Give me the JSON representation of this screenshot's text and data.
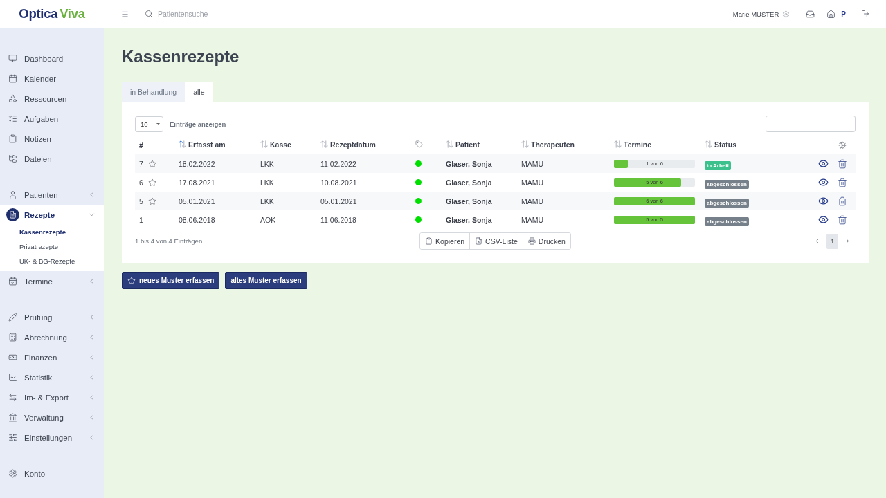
{
  "topbar": {
    "logo": {
      "part_1": "Optica",
      "part_2": "Viva"
    },
    "search": {
      "placeholder": "Patientensuche"
    },
    "user": "Marie MUSTER",
    "practice": "P"
  },
  "sidebar": {
    "groups": [
      {
        "items": [
          {
            "label": "Dashboard",
            "kind": "link",
            "selected": false
          },
          {
            "label": "Kalender",
            "kind": "link",
            "selected": false
          },
          {
            "label": "Ressourcen",
            "kind": "link",
            "selected": false
          },
          {
            "label": "Aufgaben",
            "kind": "link",
            "selected": false
          },
          {
            "label": "Notizen",
            "kind": "link",
            "selected": false
          },
          {
            "label": "Dateien",
            "kind": "link",
            "selected": false
          }
        ]
      },
      {
        "items": [
          {
            "label": "Patienten",
            "kind": "menu",
            "selected": false,
            "expanded": false
          },
          {
            "label": "Rezepte",
            "kind": "menu",
            "selected": true,
            "expanded": true,
            "children": [
              {
                "label": "Kassenrezepte",
                "selected": true
              },
              {
                "label": "Privatrezepte",
                "selected": false
              },
              {
                "label": "UK- & BG-Rezepte",
                "selected": false
              }
            ]
          },
          {
            "label": "Termine",
            "kind": "menu",
            "selected": false,
            "expanded": false
          }
        ]
      },
      {
        "items": [
          {
            "label": "Prüfung",
            "kind": "menu",
            "selected": false,
            "expanded": false
          },
          {
            "label": "Abrechnung",
            "kind": "menu",
            "selected": false,
            "expanded": false
          },
          {
            "label": "Finanzen",
            "kind": "menu",
            "selected": false,
            "expanded": false
          },
          {
            "label": "Statistik",
            "kind": "menu",
            "selected": false,
            "expanded": false
          },
          {
            "label": "Im- & Export",
            "kind": "menu",
            "selected": false,
            "expanded": false
          },
          {
            "label": "Verwaltung",
            "kind": "menu",
            "selected": false,
            "expanded": false
          },
          {
            "label": "Einstellungen",
            "kind": "menu",
            "selected": false,
            "expanded": false
          }
        ]
      },
      {
        "items": [
          {
            "label": "Konto",
            "kind": "link",
            "selected": false
          }
        ]
      }
    ]
  },
  "page": {
    "title": "Kassenrezepte",
    "tabs": [
      {
        "label": "in Behandlung",
        "selected": false
      },
      {
        "label": "alle",
        "selected": true
      }
    ],
    "page_length": {
      "value": "10",
      "label": "Einträge anzeigen"
    },
    "table": {
      "columns": [
        {
          "label": "#",
          "kind": "plain"
        },
        {
          "label": "Erfasst am",
          "kind": "sortable",
          "sorted": true
        },
        {
          "label": "Kasse",
          "kind": "sortable",
          "sorted": false
        },
        {
          "label": "Rezeptdatum",
          "kind": "sortable",
          "sorted": false
        },
        {
          "kind": "tag_icon"
        },
        {
          "label": "Patient",
          "kind": "sortable",
          "sorted": false
        },
        {
          "label": "Therapeuten",
          "kind": "sortable",
          "sorted": false
        },
        {
          "label": "Termine",
          "kind": "sortable",
          "sorted": false
        },
        {
          "label": "Status",
          "kind": "sortable",
          "sorted": false
        },
        {
          "kind": "settings_icon"
        }
      ],
      "rows": [
        {
          "number": "7",
          "star_icon": true,
          "recorded": "18.02.2022",
          "insurer": "LKK",
          "prescription_date": "11.02.2022",
          "tag": {
            "color": "#00e000"
          },
          "patient": "Glaser, Sonja",
          "therapist": "MAMU",
          "appointments": {
            "label": "1 von 6",
            "level": 0.167
          },
          "status": {
            "label": "in Arbeit",
            "color": "#3cc08c"
          }
        },
        {
          "number": "6",
          "star_icon": true,
          "recorded": "17.08.2021",
          "insurer": "LKK",
          "prescription_date": "10.08.2021",
          "tag": {
            "color": "#00e000"
          },
          "patient": "Glaser, Sonja",
          "therapist": "MAMU",
          "appointments": {
            "label": "5 von 6",
            "level": 0.833
          },
          "status": {
            "label": "abgeschlossen",
            "color": "#76808a"
          }
        },
        {
          "number": "5",
          "star_icon": true,
          "recorded": "05.01.2021",
          "insurer": "LKK",
          "prescription_date": "05.01.2021",
          "tag": {
            "color": "#00e000"
          },
          "patient": "Glaser, Sonja",
          "therapist": "MAMU",
          "appointments": {
            "label": "6 von 6",
            "level": 1
          },
          "status": {
            "label": "abgeschlossen",
            "color": "#76808a"
          }
        },
        {
          "number": "1",
          "star_icon": false,
          "recorded": "08.06.2018",
          "insurer": "AOK",
          "prescription_date": "11.06.2018",
          "tag": {
            "color": "#00e000"
          },
          "patient": "Glaser, Sonja",
          "therapist": "MAMU",
          "appointments": {
            "label": "5 von 5",
            "level": 1
          },
          "status": {
            "label": "abgeschlossen",
            "color": "#76808a"
          }
        }
      ]
    },
    "footer": {
      "info": "1 bis 4 von 4 Einträgen",
      "export_buttons": [
        {
          "label": "Kopieren"
        },
        {
          "label": "CSV-Liste"
        },
        {
          "label": "Drucken"
        }
      ],
      "pages": [
        {
          "label": "1",
          "selected": true
        }
      ]
    },
    "actions": [
      {
        "label": "neues Muster erfassen",
        "star_icon": true
      },
      {
        "label": "altes Muster erfassen",
        "star_icon": false
      }
    ]
  }
}
